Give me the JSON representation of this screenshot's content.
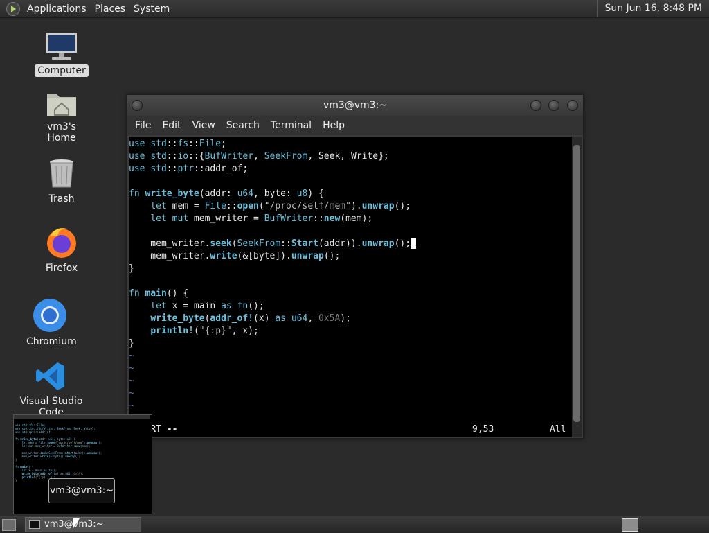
{
  "top_panel": {
    "menus": [
      "Applications",
      "Places",
      "System"
    ],
    "clock": "Sun Jun 16,  8:48 PM"
  },
  "desktop": {
    "icons": [
      {
        "label": "Computer",
        "icon": "computer-icon"
      },
      {
        "label": "vm3's Home",
        "icon": "home-folder-icon"
      },
      {
        "label": "Trash",
        "icon": "trash-icon"
      },
      {
        "label": "Firefox",
        "icon": "firefox-icon"
      },
      {
        "label": "Chromium",
        "icon": "chromium-icon"
      },
      {
        "label": "Visual Studio Code",
        "icon": "vscode-icon"
      }
    ]
  },
  "window": {
    "title": "vm3@vm3:~",
    "menu": [
      "File",
      "Edit",
      "View",
      "Search",
      "Terminal",
      "Help"
    ],
    "code_lines": [
      "use std::fs::File;",
      "use std::io::{BufWriter, SeekFrom, Seek, Write};",
      "use std::ptr::addr_of;",
      "",
      "fn write_byte(addr: u64, byte: u8) {",
      "    let mem = File::open(\"/proc/self/mem\").unwrap();",
      "    let mut mem_writer = BufWriter::new(mem);",
      "",
      "    mem_writer.seek(SeekFrom::Start(addr)).unwrap();",
      "    mem_writer.write(&[byte]).unwrap();",
      "}",
      "",
      "fn main() {",
      "    let x = main as fn();",
      "    write_byte(addr_of!(x) as u64, 0x5A);",
      "    println!(\"{:p}\", x);",
      "}"
    ],
    "status_mode": "INSERT --",
    "status_pos": "9,53",
    "status_pct": "All"
  },
  "preview": {
    "tooltip": "vm3@vm3:~"
  },
  "taskbar": {
    "task_label": "vm3@vm3:~"
  }
}
